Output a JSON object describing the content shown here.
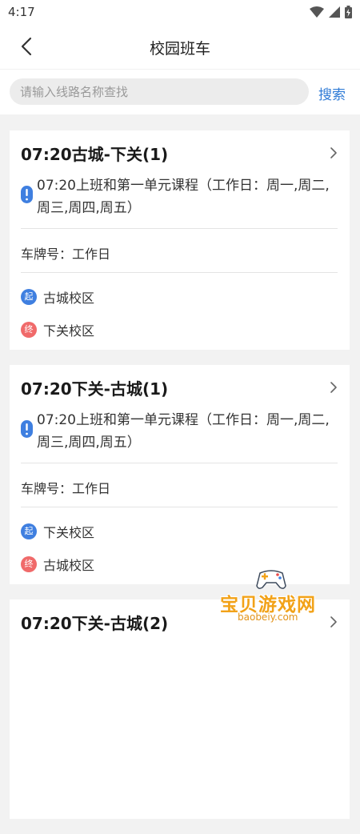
{
  "status_bar": {
    "time": "4:17",
    "icons": [
      "wifi-icon",
      "signal-icon",
      "battery-charging-icon"
    ]
  },
  "nav": {
    "back_icon": "chevron-left-icon",
    "title": "校园班车"
  },
  "search": {
    "placeholder": "请输入线路名称查找",
    "value": "",
    "button_label": "搜索"
  },
  "routes": [
    {
      "title": "07:20古城-下关(1)",
      "description": "07:20上班和第一单元课程（工作日：周一,周二,周三,周四,周五）",
      "plate": "车牌号：工作日",
      "start_badge": "起",
      "start": "古城校区",
      "end_badge": "终",
      "end": "下关校区"
    },
    {
      "title": "07:20下关-古城(1)",
      "description": "07:20上班和第一单元课程（工作日：周一,周二,周三,周四,周五）",
      "plate": "车牌号：工作日",
      "start_badge": "起",
      "start": "下关校区",
      "end_badge": "终",
      "end": "古城校区"
    },
    {
      "title": "07:20下关-古城(2)"
    }
  ],
  "colors": {
    "accent": "#2f7bd6",
    "start_badge": "#3f7fe0",
    "end_badge": "#f06a6a",
    "info_icon": "#3f7fe0",
    "page_bg": "#f2f2f2",
    "card_bg": "#ffffff"
  },
  "watermark": {
    "text": "宝贝游戏网",
    "url": "baobeiy.com"
  }
}
